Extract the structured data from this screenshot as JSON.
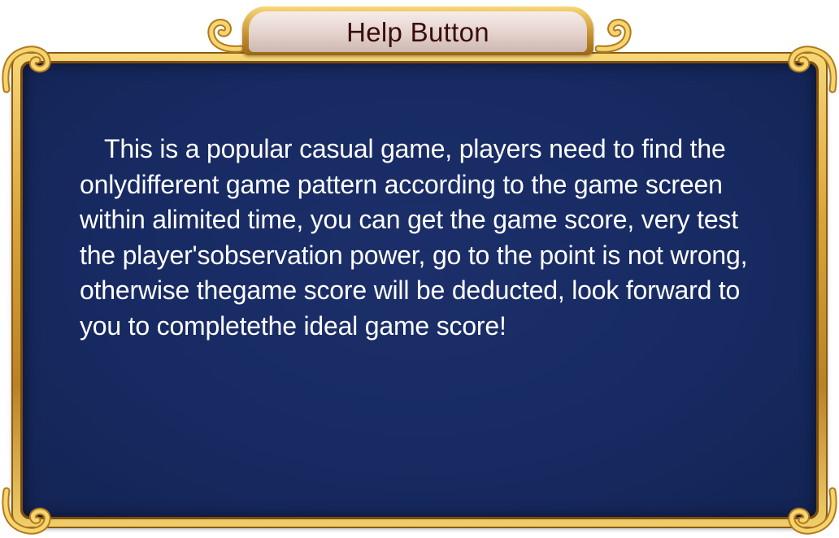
{
  "dialog": {
    "title": "Help Button",
    "body_text": "This is a popular casual game, players need to find the onlydifferent game pattern according to the game screen within alimited time, you can get the game score, very test the player'sobservation power, go to the point is not wrong, otherwise thegame score will be deducted, look forward to you to completethe ideal game score!"
  },
  "icons": {
    "corner_ornament": "gold-scroll-ornament-icon",
    "title_ornament": "gold-swirl-ornament-icon"
  },
  "colors": {
    "panel_blue": "#172a62",
    "gold": "#d9a53a",
    "title_text": "#3a0c0c",
    "body_text": "#ffffff"
  }
}
